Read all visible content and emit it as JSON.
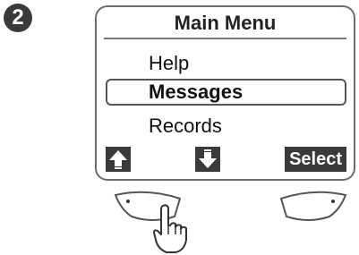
{
  "step": {
    "number": "2"
  },
  "screen": {
    "title": "Main Menu",
    "items": [
      {
        "label": "Help",
        "selected": false
      },
      {
        "label": "Messages",
        "selected": true
      },
      {
        "label": "Records",
        "selected": false
      }
    ]
  },
  "softkeys": {
    "left_icon": "arrow-up-icon",
    "middle_icon": "arrow-down-icon",
    "right_label": "Select"
  },
  "colors": {
    "display_dark": "#3a3a3a",
    "outline": "#6e6e6e"
  }
}
